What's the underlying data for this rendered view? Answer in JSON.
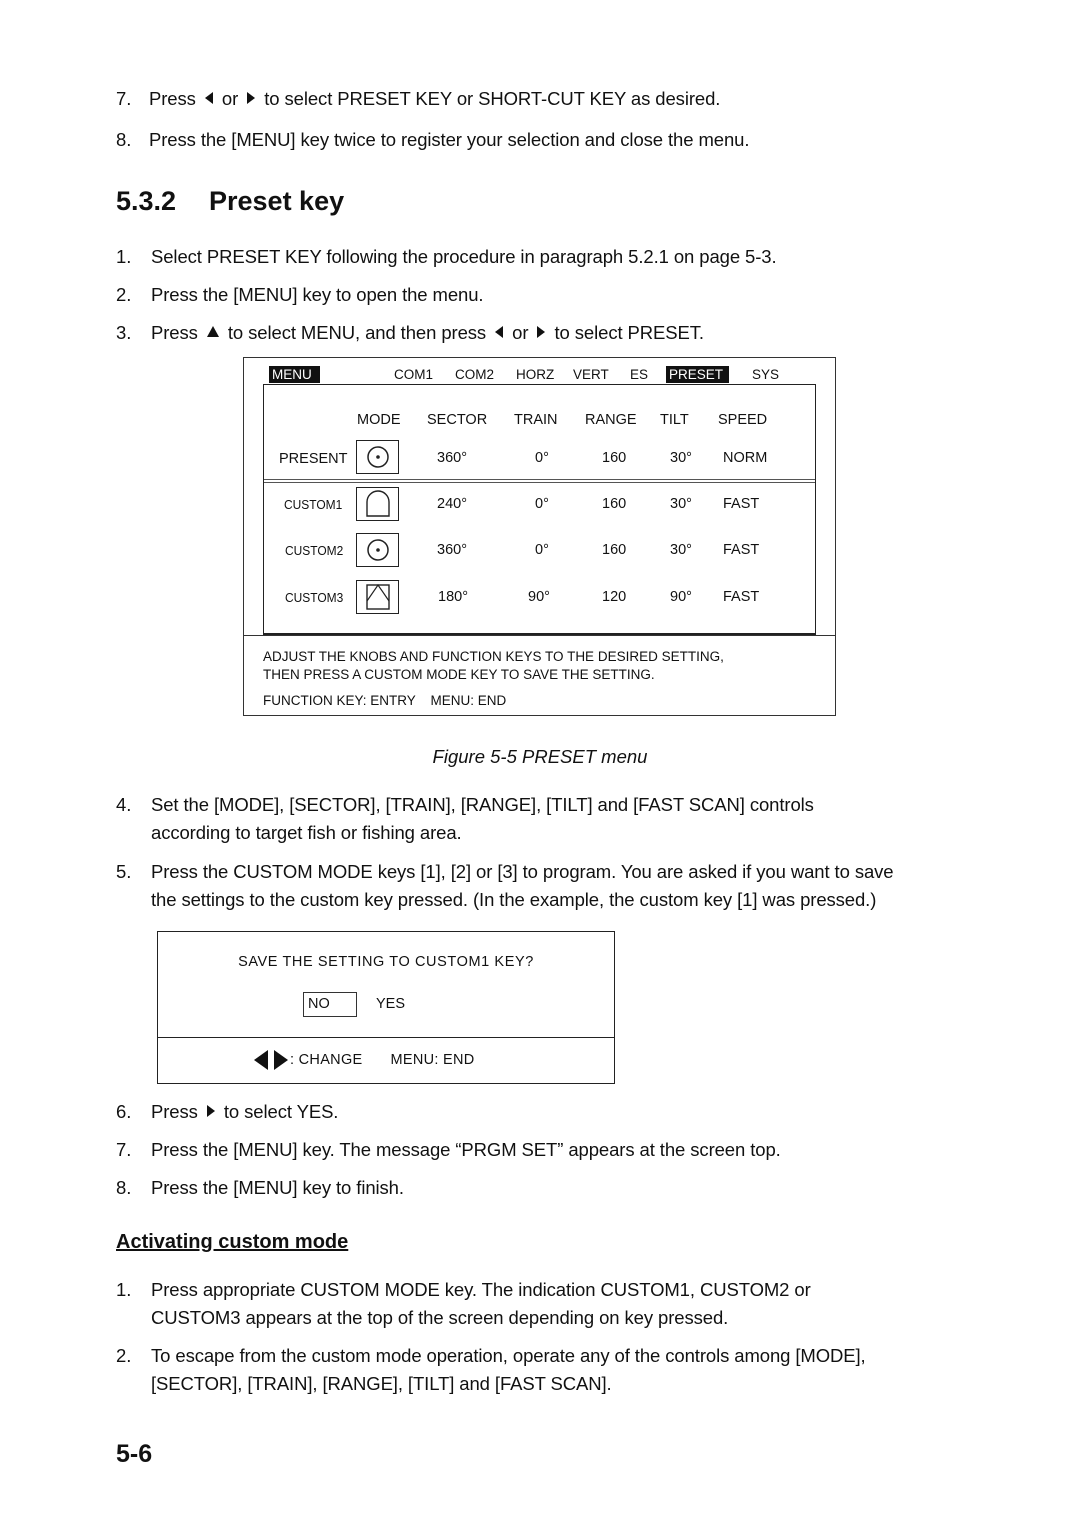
{
  "intro_steps": [
    {
      "num": "7.",
      "pre": "Press",
      "mid": "or",
      "post": "to select PRESET KEY or SHORT-CUT KEY as desired."
    },
    {
      "num": "8.",
      "text": "Press the [MENU] key twice to register your selection and close the menu."
    }
  ],
  "section": {
    "number": "5.3.2",
    "title": "Preset key"
  },
  "steps_a": [
    {
      "num": "1.",
      "text": "Select PRESET KEY following the procedure in paragraph 5.2.1 on page 5-3."
    },
    {
      "num": "2.",
      "text": "Press the [MENU] key to open the menu."
    },
    {
      "num": "3.",
      "pre": "Press",
      "mid1": "to select MENU, and then press",
      "mid2": "or",
      "post": "to select PRESET."
    }
  ],
  "preset_menu": {
    "tabs": [
      {
        "label": "MENU",
        "active": true
      },
      {
        "label": "COM1",
        "active": false
      },
      {
        "label": "COM2",
        "active": false
      },
      {
        "label": "HORZ",
        "active": false
      },
      {
        "label": "VERT",
        "active": false
      },
      {
        "label": "ES",
        "active": false
      },
      {
        "label": "PRESET",
        "active": true
      },
      {
        "label": "SYS",
        "active": false
      }
    ],
    "columns": [
      "MODE",
      "SECTOR",
      "TRAIN",
      "RANGE",
      "TILT",
      "SPEED"
    ],
    "rows": [
      {
        "label": "PRESENT",
        "mode_icon": "circle-dot-icon",
        "sector": "360°",
        "train": "0°",
        "range": "160",
        "tilt": "30°",
        "speed": "NORM"
      },
      {
        "label": "CUSTOM1",
        "mode_icon": "arch-sector-icon",
        "sector": "240°",
        "train": "0°",
        "range": "160",
        "tilt": "30°",
        "speed": "FAST"
      },
      {
        "label": "CUSTOM2",
        "mode_icon": "circle-dot-icon",
        "sector": "360°",
        "train": "0°",
        "range": "160",
        "tilt": "30°",
        "speed": "FAST"
      },
      {
        "label": "CUSTOM3",
        "mode_icon": "triangle-sector-icon",
        "sector": "180°",
        "train": "90°",
        "range": "120",
        "tilt": "90°",
        "speed": "FAST"
      }
    ],
    "message_line1": "ADJUST THE KNOBS AND FUNCTION KEYS TO THE DESIRED SETTING,",
    "message_line2": "THEN PRESS A CUSTOM MODE KEY TO SAVE THE SETTING.",
    "footer": "FUNCTION KEY: ENTRY    MENU: END"
  },
  "figure_caption": "Figure 5-5 PRESET menu",
  "steps_b": [
    {
      "num": "4.",
      "line1": "Set the [MODE], [SECTOR], [TRAIN], [RANGE], [TILT] and [FAST SCAN] controls",
      "line2": "according to target fish or fishing area."
    },
    {
      "num": "5.",
      "line1": "Press the CUSTOM MODE keys [1], [2] or [3] to program. You are asked if you want to save",
      "line2": "the settings to the custom key pressed. (In the example, the custom key [1] was pressed.)"
    }
  ],
  "save_dialog": {
    "question": "SAVE THE SETTING TO CUSTOM1 KEY?",
    "option_no": "NO",
    "option_yes": "YES",
    "selected": "NO",
    "footer_change": ": CHANGE",
    "footer_end": "MENU: END"
  },
  "steps_c": [
    {
      "num": "6.",
      "pre": "Press",
      "post": "to select YES."
    },
    {
      "num": "7.",
      "text": "Press the [MENU] key. The message “PRGM SET” appears at the screen top."
    },
    {
      "num": "8.",
      "text": "Press the [MENU] key to finish."
    }
  ],
  "subsection_title": "Activating custom mode",
  "steps_d": [
    {
      "num": "1.",
      "line1": "Press appropriate CUSTOM MODE key. The indication CUSTOM1, CUSTOM2 or",
      "line2": "CUSTOM3 appears at the top of the screen depending on key pressed."
    },
    {
      "num": "2.",
      "line1": "To escape from the custom mode operation, operate any of the controls among [MODE],",
      "line2": "[SECTOR], [TRAIN], [RANGE], [TILT] and [FAST SCAN]."
    }
  ],
  "page_number": "5-6"
}
